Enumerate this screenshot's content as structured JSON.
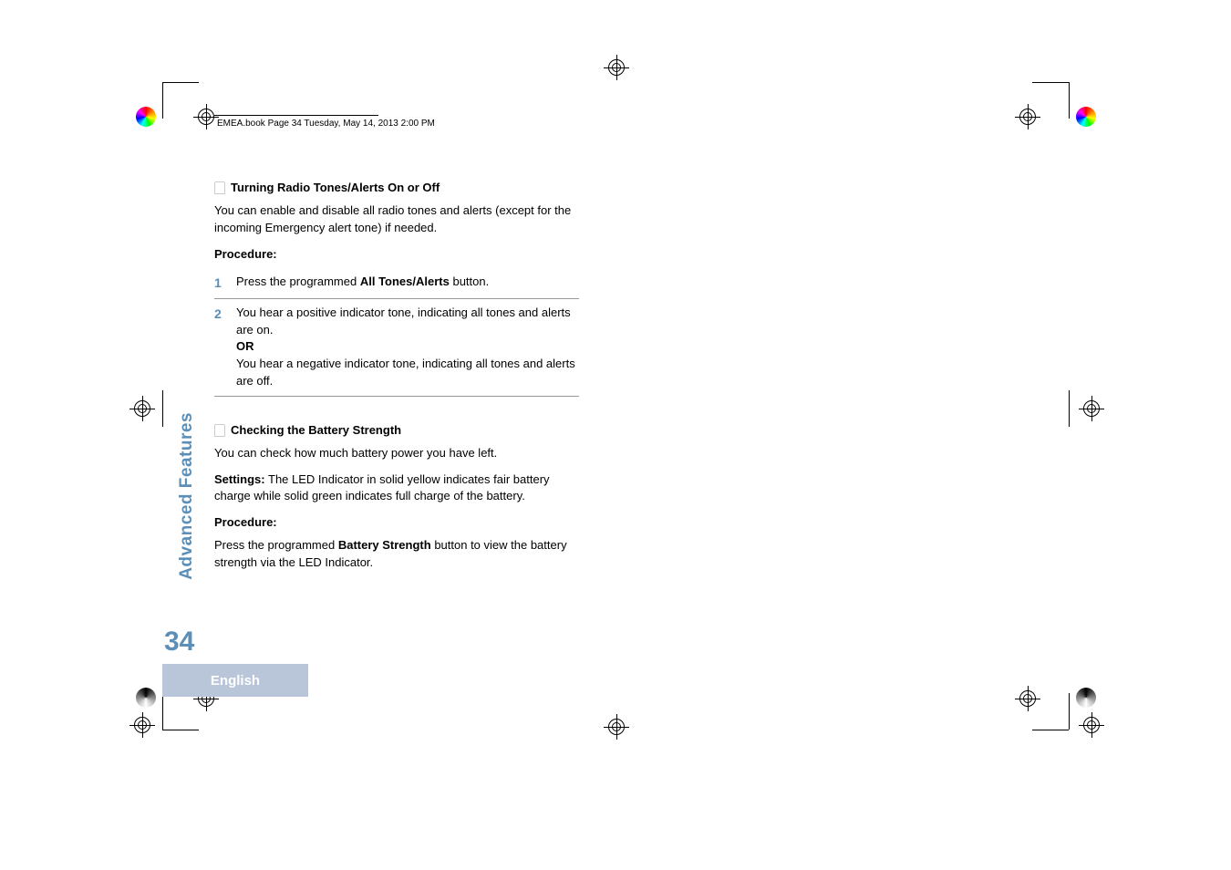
{
  "header": {
    "text": "EMEA.book  Page 34  Tuesday, May 14, 2013  2:00 PM"
  },
  "sidebar": {
    "tab": "Advanced Features",
    "page_number": "34",
    "language": "English"
  },
  "section1": {
    "heading": "Turning Radio Tones/Alerts On or Off",
    "intro": "You can enable and disable all radio tones and alerts (except for the incoming Emergency alert tone) if needed.",
    "procedure_label": "Procedure:",
    "steps": [
      {
        "num": "1",
        "text_pre": "Press the programmed ",
        "text_bold": "All Tones/Alerts",
        "text_post": " button."
      },
      {
        "num": "2",
        "line1": "You hear a positive indicator tone, indicating all tones and alerts are on.",
        "or": "OR",
        "line2": "You hear a negative indicator tone, indicating all tones and alerts are off."
      }
    ]
  },
  "section2": {
    "heading": "Checking the Battery Strength",
    "intro": "You can check how much battery power you have left.",
    "settings_label": "Settings:",
    "settings_text": " The LED Indicator in solid yellow indicates fair battery charge while solid green indicates full charge of the battery.",
    "procedure_label": "Procedure:",
    "proc_pre": "Press the programmed ",
    "proc_bold": "Battery Strength",
    "proc_post": " button to view the battery strength via the LED Indicator."
  }
}
